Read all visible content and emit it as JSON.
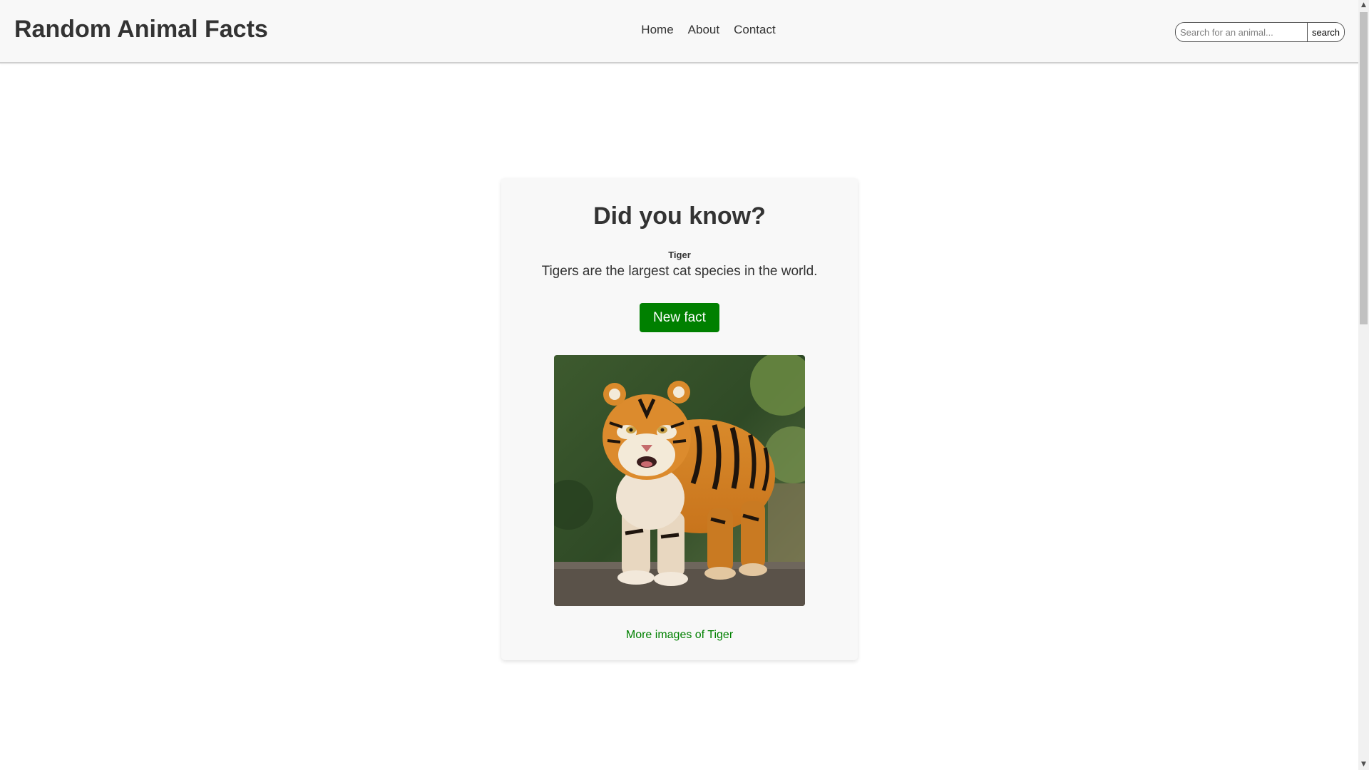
{
  "header": {
    "site_title": "Random Animal Facts",
    "nav": [
      {
        "label": "Home"
      },
      {
        "label": "About"
      },
      {
        "label": "Contact"
      }
    ],
    "search": {
      "placeholder": "Search for an animal...",
      "value": "",
      "button_label": "search"
    }
  },
  "card": {
    "heading": "Did you know?",
    "animal_name": "Tiger",
    "fact": "Tigers are the largest cat species in the world.",
    "new_fact_label": "New fact",
    "image_alt": "Tiger",
    "more_images_label": "More images of Tiger"
  },
  "colors": {
    "accent": "#008000",
    "header_bg": "#f8f8f8",
    "card_bg": "#f8f8f8",
    "text": "#333333"
  },
  "icons": {
    "scroll_up": "chevron-up-icon",
    "scroll_down": "chevron-down-icon"
  }
}
